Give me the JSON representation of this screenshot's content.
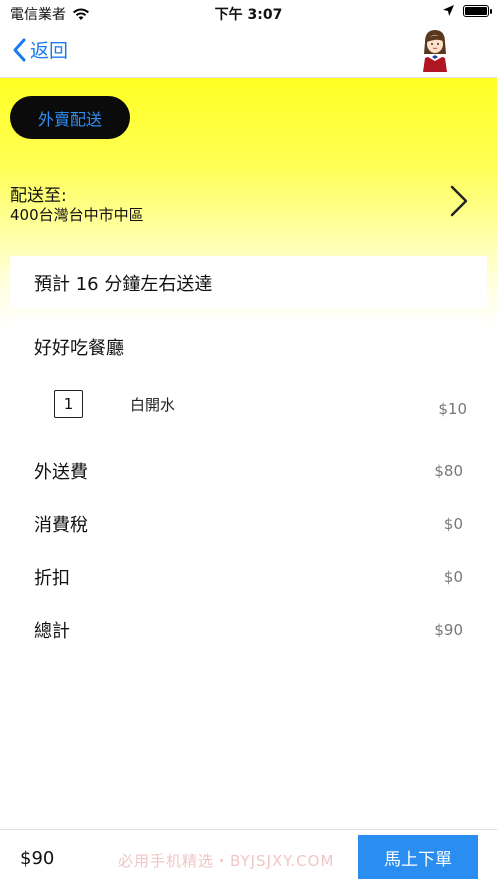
{
  "status_bar": {
    "carrier": "電信業者",
    "time": "下午 3:07"
  },
  "nav": {
    "back_label": "返回"
  },
  "delivery_mode": "外賣配送",
  "deliver_to": {
    "label": "配送至:",
    "address": "400台灣台中市中區"
  },
  "eta": "預計 16 分鐘左右送達",
  "order": {
    "restaurant": "好好吃餐廳",
    "items": [
      {
        "qty": "1",
        "name": "白開水",
        "price": "$10"
      }
    ],
    "summary": [
      {
        "label": "外送費",
        "value": "$80"
      },
      {
        "label": "消費稅",
        "value": "$0"
      },
      {
        "label": "折扣",
        "value": "$0"
      },
      {
        "label": "總計",
        "value": "$90"
      }
    ]
  },
  "footer": {
    "total": "$90",
    "order_button": "馬上下單",
    "watermark": "必用手机精选・BYJSJXY.COM"
  },
  "colors": {
    "accent": "#2a8ef0",
    "back_blue": "#1a7bf0",
    "pill_bg": "#0b0b0b",
    "yellow": "#ffff23"
  }
}
